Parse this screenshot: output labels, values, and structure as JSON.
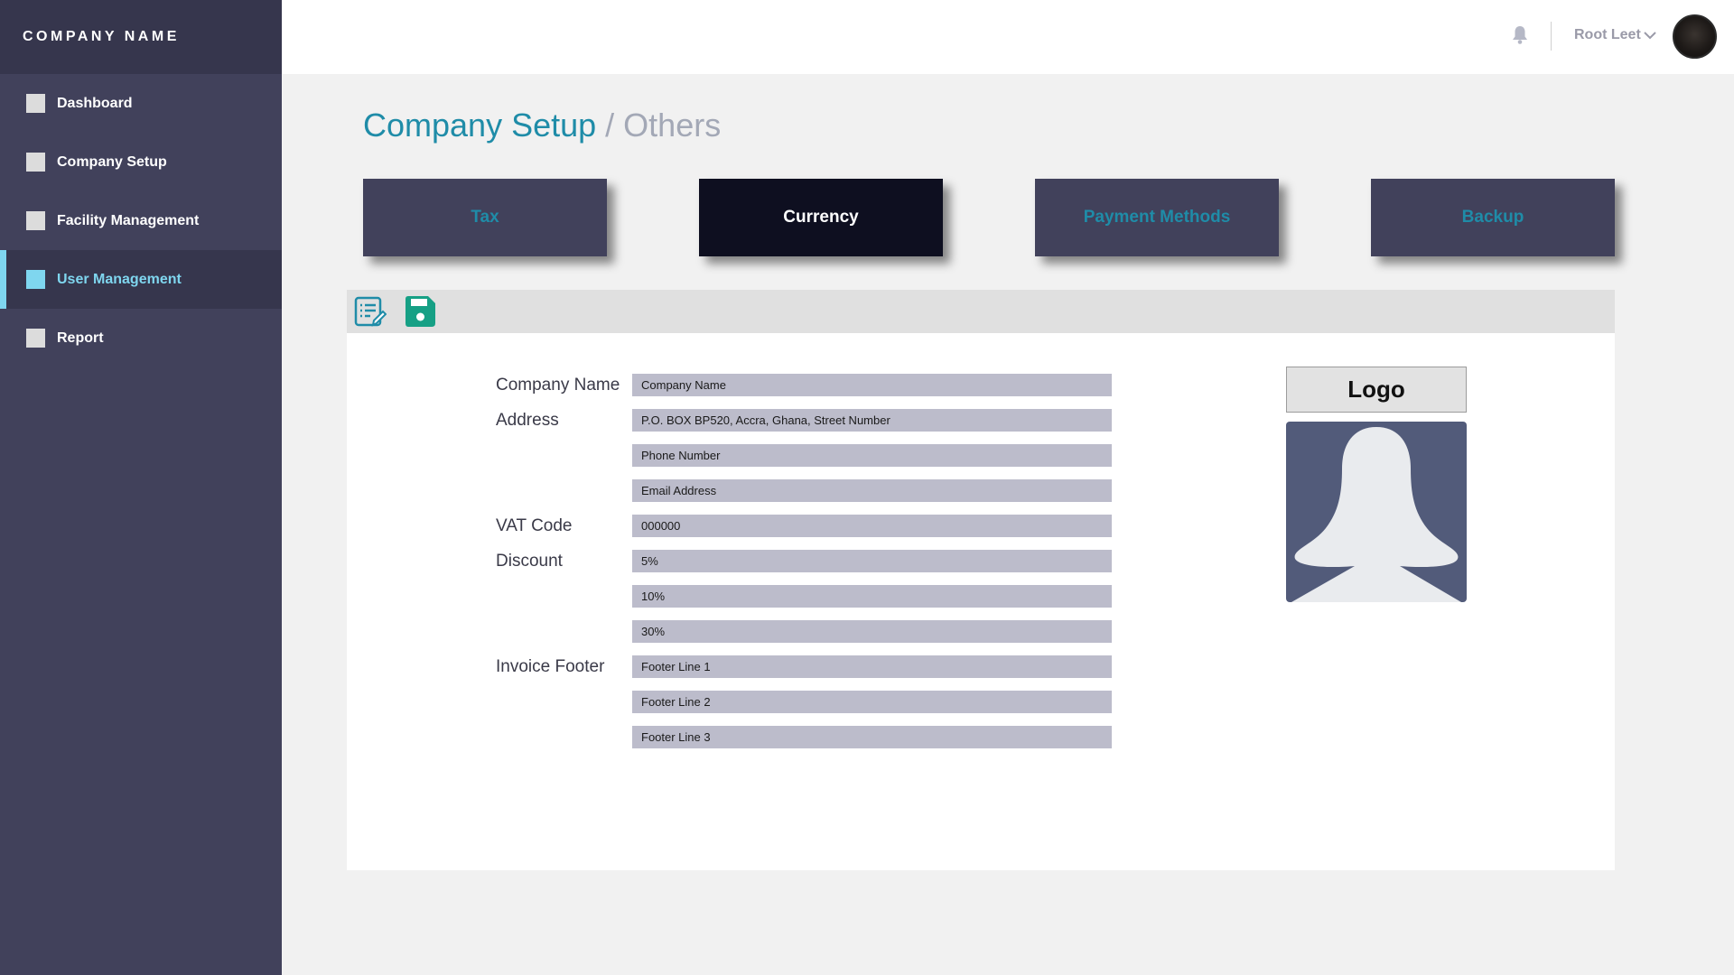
{
  "sidebar": {
    "brand": "COMPANY NAME",
    "items": [
      {
        "label": "Dashboard"
      },
      {
        "label": "Company Setup"
      },
      {
        "label": "Facility Management"
      },
      {
        "label": "User Management",
        "active": true
      },
      {
        "label": "Report"
      }
    ]
  },
  "header": {
    "user_name": "Root Leet",
    "icons": [
      "bell-icon",
      "chevron-down-icon",
      "avatar"
    ]
  },
  "page": {
    "title": "Company Setup",
    "subtitle": "/ Others"
  },
  "tabs": [
    {
      "label": "Tax"
    },
    {
      "label": "Currency",
      "active": true
    },
    {
      "label": "Payment Methods"
    },
    {
      "label": "Backup"
    }
  ],
  "toolbar": {
    "icons": [
      "edit-list-icon",
      "save-icon"
    ]
  },
  "form": {
    "labels": {
      "company_name": "Company Name",
      "address": "Address",
      "vat_code": "VAT Code",
      "discount": "Discount",
      "invoice_footer": "Invoice Footer"
    },
    "fields": {
      "company_name": "Company Name",
      "address": "P.O. BOX BP520, Accra, Ghana, Street Number",
      "phone": "Phone Number",
      "email": "Email Address",
      "vat_code": "000000",
      "discount_1": "5%",
      "discount_2": "10%",
      "discount_3": "30%",
      "footer_1": "Footer Line 1",
      "footer_2": "Footer Line 2",
      "footer_3": "Footer Line 3"
    }
  },
  "logo": {
    "button_label": "Logo"
  },
  "colors": {
    "sidebar": "#41415b",
    "accent": "#1f8ca8",
    "active_nav": "#7fd6ef",
    "save_green": "#16a085"
  }
}
